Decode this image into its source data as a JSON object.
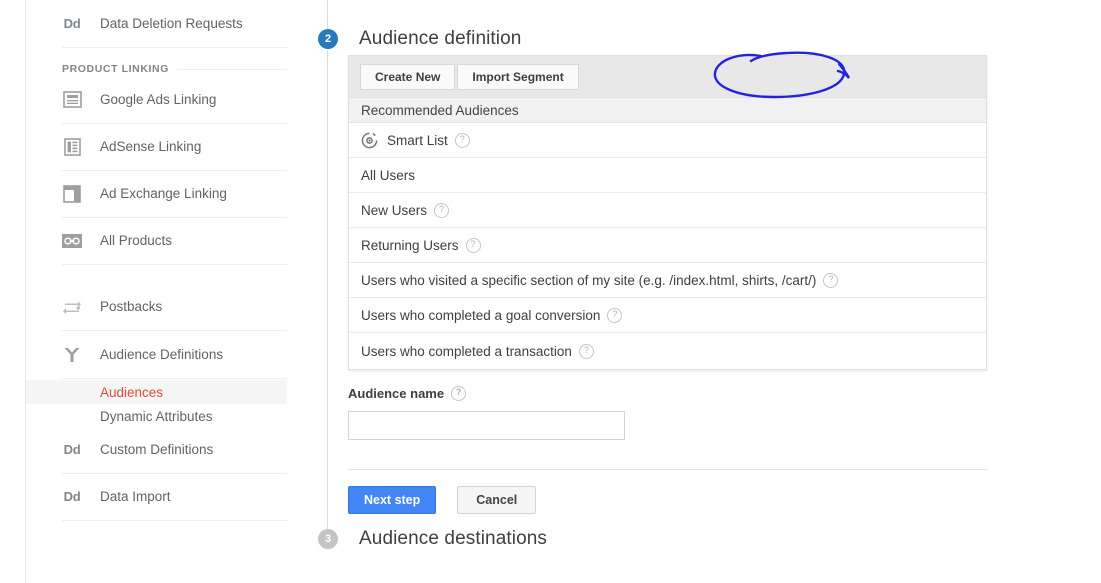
{
  "sidebar": {
    "items": [
      {
        "label": "Data Deletion Requests",
        "icon": "dd-icon",
        "name": "sidebar-item-data-deletion-requests"
      },
      {
        "label": "Google Ads Linking",
        "icon": "google-ads-linking-icon",
        "name": "sidebar-item-google-ads-linking"
      },
      {
        "label": "AdSense Linking",
        "icon": "adsense-linking-icon",
        "name": "sidebar-item-adsense-linking"
      },
      {
        "label": "Ad Exchange Linking",
        "icon": "ad-exchange-linking-icon",
        "name": "sidebar-item-ad-exchange-linking"
      },
      {
        "label": "All Products",
        "icon": "all-products-link-icon",
        "name": "sidebar-item-all-products"
      },
      {
        "label": "Postbacks",
        "icon": "postbacks-exchange-icon",
        "name": "sidebar-item-postbacks"
      },
      {
        "label": "Audience Definitions",
        "icon": "audience-definitions-branch-icon",
        "name": "sidebar-item-audience-definitions"
      },
      {
        "label": "Custom Definitions",
        "icon": "dd-icon",
        "name": "sidebar-item-custom-definitions"
      },
      {
        "label": "Data Import",
        "icon": "dd-icon",
        "name": "sidebar-item-data-import"
      }
    ],
    "section_header": "PRODUCT LINKING",
    "sub_items": [
      {
        "label": "Audiences",
        "active": true
      },
      {
        "label": "Dynamic Attributes",
        "active": false
      }
    ],
    "active_color": "#dd4b39"
  },
  "steps": {
    "current": {
      "number": "2",
      "title": "Audience definition",
      "badge_color": "#2a7ab9"
    },
    "next": {
      "number": "3",
      "title": "Audience destinations",
      "badge_color": "#c4c4c4"
    }
  },
  "panel": {
    "tabs": [
      {
        "label": "Create New",
        "name": "tab-create-new"
      },
      {
        "label": "Import Segment",
        "name": "tab-import-segment"
      }
    ],
    "list_header": "Recommended Audiences",
    "rows": [
      {
        "label": "Smart List",
        "help": true,
        "icon": "smart-list-icon"
      },
      {
        "label": "All Users",
        "help": false,
        "icon": null
      },
      {
        "label": "New Users",
        "help": true,
        "icon": null
      },
      {
        "label": "Returning Users",
        "help": true,
        "icon": null
      },
      {
        "label": "Users who visited a specific section of my site (e.g. /index.html, shirts, /cart/)",
        "help": true,
        "icon": null
      },
      {
        "label": "Users who completed a goal conversion",
        "help": true,
        "icon": null
      },
      {
        "label": "Users who completed a transaction",
        "help": true,
        "icon": null
      }
    ]
  },
  "form": {
    "audience_name_label": "Audience name",
    "audience_name_value": "",
    "audience_name_placeholder": "",
    "help_glyph": "?"
  },
  "buttons": {
    "next_step": "Next step",
    "cancel": "Cancel",
    "primary_color": "#4285f4"
  },
  "annotation": {
    "shape": "hand-drawn-ellipse",
    "color": "#2323dd",
    "target": "Import Segment"
  }
}
